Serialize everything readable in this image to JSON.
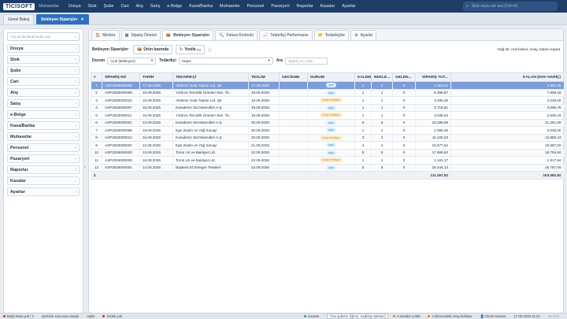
{
  "app": {
    "logo": "TİCİSOFT",
    "subtitle": "Muhasebe",
    "menu": [
      "Dosya",
      "Stok",
      "Şube",
      "Cari",
      "Alış",
      "Satış",
      "e-Belge",
      "Kasa/Banka",
      "Muhasebe",
      "Personel",
      "Pazaryeri",
      "Raporlar",
      "Kasalar",
      "Ayarlar"
    ],
    "search_placeholder": "Stok veya cari ara (Ctrl+K)",
    "search_icon": "search-icon"
  },
  "doc_tabs": [
    {
      "label": "Genel Bakış"
    },
    {
      "label": "Bekleyen Siparişler",
      "close": "✕"
    }
  ],
  "sidebar": {
    "search_placeholder": "Ara ya da ekran kodu yaz",
    "items": [
      "Dosya",
      "Stok",
      "Şube",
      "Cari",
      "Alış",
      "Satış",
      "e-Belge",
      "Kasa/Banka",
      "Muhasebe",
      "Personel",
      "Pazaryeri",
      "Raporlar",
      "Kasalar",
      "Ayarlar"
    ]
  },
  "module_tabs": [
    {
      "label": "Merkez",
      "icon": "🏠"
    },
    {
      "label": "Sipariş Önerisi",
      "icon": "▦"
    },
    {
      "label": "Bekleyen Siparişler",
      "icon": "📦"
    },
    {
      "label": "Fatura Kontrolü",
      "icon": "🔍"
    },
    {
      "label": "Tedarikçi Performansı",
      "icon": "📈"
    },
    {
      "label": "Tedarikçiler",
      "icon": "🤝"
    },
    {
      "label": "Ayarlar",
      "icon": "⚙"
    }
  ],
  "toolbar": {
    "title": "Bekleyen Siparişler",
    "btn_product": "Ürün bazında",
    "btn_refresh": "Yenile",
    "refresh_key": "F5",
    "hint": "Sağ tık: mal kabul, onay, kalanı kapat"
  },
  "filters": {
    "status_label": "Durum",
    "status_value": "Açık (bekleyen)",
    "supplier_label": "Tedarikçi",
    "supplier_value": "Hepsi",
    "search_label": "Ara",
    "search_placeholder": "sipariş no, ürün"
  },
  "table": {
    "headers": [
      "#",
      "SİPARİŞ NO",
      "TARİH",
      "TEDARİKÇİ",
      "TESLİM",
      "GECİKME",
      "DURUM",
      "KALEM",
      "BEKLE...",
      "GELEN...",
      "SİPARİŞ TUT...",
      "KALAN (KDV HARİÇ)"
    ],
    "rows": [
      {
        "n": "1",
        "no": "ASP2026000009",
        "tarih": "17.09.2026",
        "ted": "Akdeniz Gıda Toptan Ltd. Şti.",
        "teslim": "17.09.2026",
        "gec": "",
        "durum": "açık",
        "kalem": "1",
        "bek": "1",
        "gel": "0",
        "tut": "1.315,02",
        "kalan": "1.302,00"
      },
      {
        "n": "2",
        "no": "ASP2026000006",
        "tarih": "15.09.2026",
        "ted": "Yıldırım Temizlik Ürünleri San. Tic.",
        "teslim": "18.09.2026",
        "gec": "",
        "durum": "açık",
        "kalem": "1",
        "bek": "1",
        "gel": "0",
        "tut": "8.368,97",
        "kalan": "7.608,15"
      },
      {
        "n": "3",
        "no": "ASP2026000010",
        "tarih": "16.09.2026",
        "ted": "Akdeniz Gıda Toptan Ltd. Şti.",
        "teslim": "18.09.2026",
        "gec": "",
        "durum": "onay bekliyor",
        "kalem": "1",
        "bek": "1",
        "gel": "0",
        "tut": "3.280,48",
        "kalan": "3.248,00"
      },
      {
        "n": "4",
        "no": "ASP2026000007",
        "tarih": "15.09.2026",
        "ted": "Karadeniz Süt Mamulleri A.Ş.",
        "teslim": "19.09.2026",
        "gec": "",
        "durum": "açık",
        "kalem": "1",
        "bek": "1",
        "gel": "0",
        "tut": "3.718,51",
        "kalan": "3.098,76"
      },
      {
        "n": "5",
        "no": "ASP2026000011",
        "tarih": "16.09.2026",
        "ted": "Yıldırım Temizlik Ürünleri San. Tic.",
        "teslim": "19.09.2026",
        "gec": "",
        "durum": "onay bekliyor",
        "kalem": "1",
        "bek": "1",
        "gel": "0",
        "tut": "3.036,53",
        "kalan": "2.530,44"
      },
      {
        "n": "6",
        "no": "ASP2026000001",
        "tarih": "13.09.2026",
        "ted": "Karadeniz Süt Mamulleri A.Ş.",
        "teslim": "20.09.2026",
        "gec": "",
        "durum": "açık",
        "kalem": "5",
        "bek": "5",
        "gel": "0",
        "tut": "23.286,66",
        "kalan": "21.251,00"
      },
      {
        "n": "7",
        "no": "ASP2026000008",
        "tarih": "15.09.2026",
        "ted": "Ege Zeytin ve Yağ Sanayi",
        "teslim": "20.09.2026",
        "gec": "",
        "durum": "açık",
        "kalem": "1",
        "bek": "1",
        "gel": "0",
        "tut": "2.068,48",
        "kalan": "2.048,00"
      },
      {
        "n": "8",
        "no": "ASP2026000012",
        "tarih": "16.09.2026",
        "ted": "Karadeniz Süt Mamulleri A.Ş.",
        "teslim": "20.09.2026",
        "gec": "",
        "durum": "onay bekliyor",
        "kalem": "3",
        "bek": "3",
        "gel": "0",
        "tut": "11.100,33",
        "kalan": "10.990,43"
      },
      {
        "n": "9",
        "no": "ASP2026000002",
        "tarih": "12.09.2026",
        "ted": "Ege Zeytin ve Yağ Sanayi",
        "teslim": "21.09.2026",
        "gec": "",
        "durum": "açık",
        "kalem": "4",
        "bek": "4",
        "gel": "0",
        "tut": "16.577,62",
        "kalan": "15.587,00"
      },
      {
        "n": "10",
        "no": "ASP2026000003",
        "tarih": "13.09.2026",
        "ted": "Toros Un ve Bakliyat Ltd.",
        "teslim": "22.09.2026",
        "gec": "",
        "durum": "açık",
        "kalem": "5",
        "bek": "5",
        "gel": "0",
        "tut": "17.889,62",
        "kalan": "16.794,50"
      },
      {
        "n": "11",
        "no": "ASP2026000009",
        "tarih": "16.09.2026",
        "ted": "Toros Un ve Bakliyat Ltd.",
        "teslim": "22.09.2026",
        "gec": "",
        "durum": "onay bekliyor",
        "kalem": "1",
        "bek": "1",
        "gel": "0",
        "tut": "2.181,17",
        "kalan": "1.817,64"
      },
      {
        "n": "12",
        "no": "ASP2026000004",
        "tarih": "14.09.2026",
        "ted": "Başkent Et Entegre Tesisleri",
        "teslim": "23.09.2026",
        "gec": "",
        "durum": "açık",
        "kalem": "5",
        "bek": "5",
        "gel": "0",
        "tut": "18.444,13",
        "kalan": "16.787,00"
      }
    ],
    "total_label": "Σ",
    "total_tut": "111.267,52",
    "total_kalan": "103.062,92"
  },
  "status_bar": {
    "left1": "Bağlı kasa yok / 3",
    "left2": "Şerkisin sunucusu kapalı",
    "left3": "sqlite",
    "left4": "Yedek yok",
    "license": "Lisanslı",
    "branch": "Tüm şubeler (İşlem: Kadıköy Merkez)",
    "transfer": "1 transfer yolda",
    "approval": "2 ilimal talebi onay bekliyor",
    "user": "Ahmet Karaca",
    "datetime": "17.09.2026 21:21",
    "version": "v2.12.0"
  },
  "colors": {
    "topbar": "#1e3d66",
    "active_tab": "#2f6fc0",
    "selected_row": "#7d9dd8",
    "badge_open": "#2a86c4",
    "badge_waiting": "#c78a1c"
  }
}
